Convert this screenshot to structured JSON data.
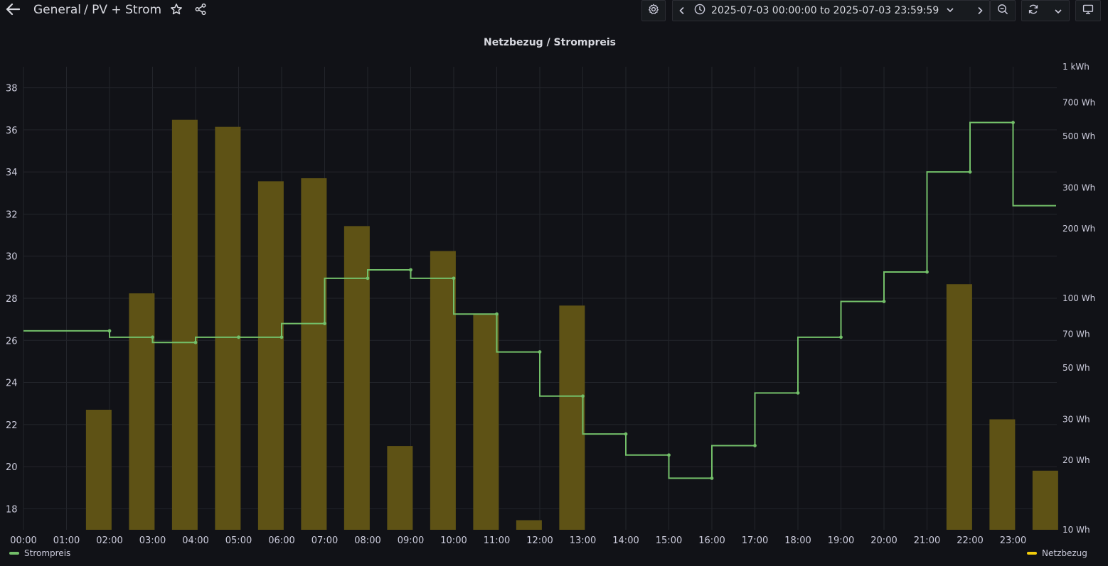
{
  "header": {
    "folder": "General",
    "dashboard": "/ PV + Strom",
    "time_range": "2025-07-03 00:00:00 to 2025-07-03 23:59:59",
    "icons": [
      "arrow-left-icon",
      "star-icon",
      "share-icon",
      "gear-icon",
      "chevron-left-icon",
      "clock-icon",
      "chevron-down-icon",
      "chevron-right-icon",
      "zoom-out-icon",
      "refresh-icon",
      "chevron-down-icon",
      "tv-icon"
    ]
  },
  "panel": {
    "title": "Netzbezug / Strompreis"
  },
  "chart_data": {
    "type": "bar+line",
    "title": "Netzbezug / Strompreis",
    "x_ticks": [
      "00:00",
      "01:00",
      "02:00",
      "03:00",
      "04:00",
      "05:00",
      "06:00",
      "07:00",
      "08:00",
      "09:00",
      "10:00",
      "11:00",
      "12:00",
      "13:00",
      "14:00",
      "15:00",
      "16:00",
      "17:00",
      "18:00",
      "19:00",
      "20:00",
      "21:00",
      "22:00",
      "23:00"
    ],
    "y_left": {
      "ticks": [
        18,
        20,
        22,
        24,
        26,
        28,
        30,
        32,
        34,
        36,
        38
      ],
      "range": [
        17,
        39
      ]
    },
    "y_right": {
      "scale": "log",
      "ticks_wh": [
        10,
        20,
        30,
        50,
        70,
        100,
        200,
        300,
        500,
        700,
        1000
      ],
      "tick_labels": [
        "10 Wh",
        "20 Wh",
        "30 Wh",
        "50 Wh",
        "70 Wh",
        "100 Wh",
        "200 Wh",
        "300 Wh",
        "500 Wh",
        "700 Wh",
        "1 kWh"
      ],
      "range_wh": [
        10,
        1000
      ]
    },
    "series": [
      {
        "name": "Strompreis",
        "axis": "left",
        "color": "#73bf69",
        "style": "step-after",
        "x_hours": [
          0,
          2,
          3,
          4,
          5,
          6,
          7,
          8,
          9,
          10,
          11,
          12,
          13,
          14,
          15,
          16,
          17,
          18,
          19,
          20,
          21,
          22,
          23,
          24
        ],
        "values": [
          26.45,
          26.15,
          25.9,
          26.15,
          26.15,
          26.8,
          28.95,
          29.35,
          28.95,
          27.25,
          25.45,
          23.35,
          21.55,
          20.55,
          19.45,
          21.0,
          23.5,
          26.15,
          27.85,
          29.25,
          34.0,
          36.35,
          32.4,
          32.4
        ]
      },
      {
        "name": "Netzbezug",
        "axis": "right",
        "color": "#5e5215",
        "legend_color": "#f2cc0c",
        "style": "bars",
        "x_hours": [
          1.75,
          2.75,
          3.75,
          4.75,
          5.75,
          6.75,
          7.75,
          8.75,
          9.75,
          10.75,
          11.75,
          12.75,
          21.75,
          22.75,
          23.75
        ],
        "values_wh": [
          33,
          105,
          590,
          550,
          320,
          330,
          205,
          23,
          160,
          85,
          11,
          93,
          115,
          30,
          18
        ]
      }
    ],
    "legend": [
      {
        "name": "Strompreis",
        "placement": "bottom-left"
      },
      {
        "name": "Netzbezug",
        "placement": "bottom-right"
      }
    ],
    "grid": true
  }
}
